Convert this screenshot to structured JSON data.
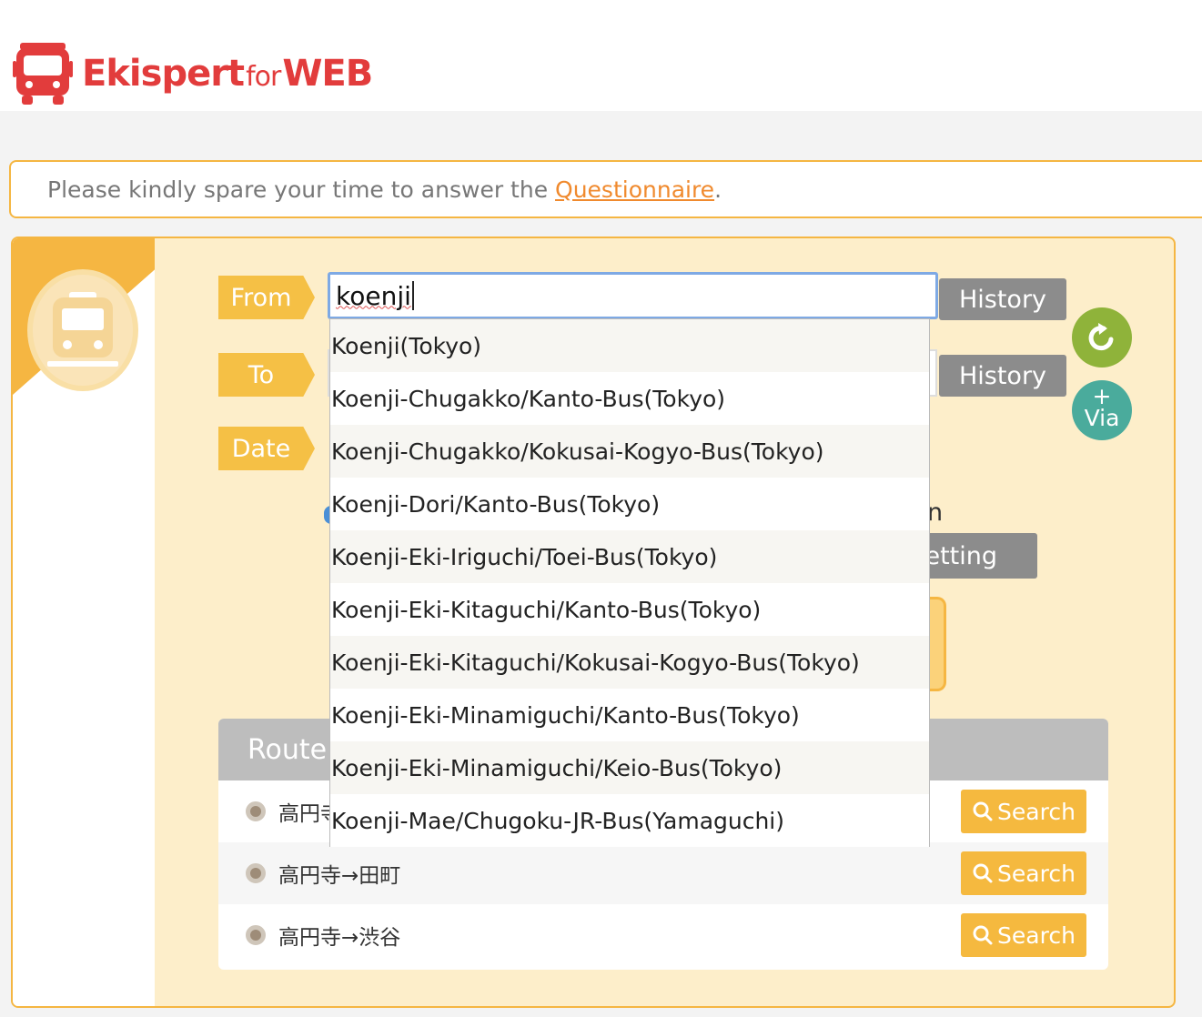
{
  "brand": {
    "name_main": "Ekispert",
    "name_for": "for",
    "name_web": "WEB",
    "color": "#e23c3c"
  },
  "notice": {
    "text": "Please kindly spare your time to answer the ",
    "link": "Questionnaire",
    "end": "."
  },
  "form": {
    "from_label": "From",
    "to_label": "To",
    "date_label": "Date",
    "from_value": "koenji",
    "history_label": "History",
    "via_plus": "+",
    "via_label": "Via",
    "setting_partial": "etting",
    "peek_n": "n"
  },
  "suggestions": [
    "Koenji(Tokyo)",
    "Koenji-Chugakko/Kanto-Bus(Tokyo)",
    "Koenji-Chugakko/Kokusai-Kogyo-Bus(Tokyo)",
    "Koenji-Dori/Kanto-Bus(Tokyo)",
    "Koenji-Eki-Iriguchi/Toei-Bus(Tokyo)",
    "Koenji-Eki-Kitaguchi/Kanto-Bus(Tokyo)",
    "Koenji-Eki-Kitaguchi/Kokusai-Kogyo-Bus(Tokyo)",
    "Koenji-Eki-Minamiguchi/Kanto-Bus(Tokyo)",
    "Koenji-Eki-Minamiguchi/Keio-Bus(Tokyo)",
    "Koenji-Mae/Chugoku-JR-Bus(Yamaguchi)"
  ],
  "routes": {
    "header": "Route",
    "search_label": "Search",
    "items": [
      {
        "label": "高円寺"
      },
      {
        "label": "高円寺→田町"
      },
      {
        "label": "高円寺→渋谷"
      }
    ]
  },
  "colors": {
    "accent_orange": "#f5b642",
    "panel_bg": "#fdeeca",
    "swap_green": "#8fb33a",
    "via_teal": "#4aab9c"
  }
}
